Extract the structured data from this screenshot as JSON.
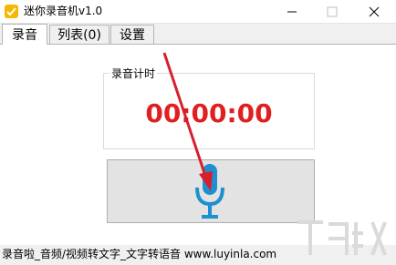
{
  "window": {
    "title": "迷你录音机v1.0",
    "minimize_glyph": "—",
    "maximize_glyph": "☐",
    "close_glyph": "✕"
  },
  "tabs": [
    {
      "label": "录音",
      "active": true
    },
    {
      "label": "列表(0)",
      "active": false
    },
    {
      "label": "设置",
      "active": false
    }
  ],
  "recorder": {
    "group_label": "录音计时",
    "timer": "00:00:00",
    "record_icon": "microphone-icon"
  },
  "footer": {
    "text": "录音啦_音频/视频转文字_文字转语音 www.luyinla.com"
  },
  "colors": {
    "timer": "#e02020",
    "mic": "#1e90d0",
    "arrow": "#d8202a",
    "app_icon": "#f5b800"
  }
}
